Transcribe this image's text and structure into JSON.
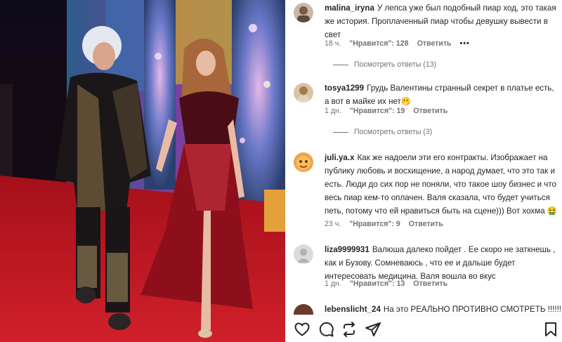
{
  "comments": [
    {
      "username": "malina_iryna",
      "text": "У лепса уже был подобный пиар ход, это такая же история. Проплаченный пиар чтобы девушку вывести в свет",
      "time": "18 ч.",
      "likes": "\"Нравится\": 128",
      "reply": "Ответить",
      "more": "•••",
      "view_replies": "Посмотреть ответы (13)"
    },
    {
      "username": "tosya1299",
      "text": "Грудь Валентины странный секрет в платье есть, а вот в майке их нет🫢",
      "time": "1 дн.",
      "likes": "\"Нравится\": 19",
      "reply": "Ответить",
      "view_replies": "Посмотреть ответы (3)"
    },
    {
      "username": "juli.ya.x",
      "text": "Как же надоели эти его контракты. Изображает на публику любовь и восхищение, а народ думает, что это так и есть. Люди до сих пор не поняли, что такое шоу бизнес и что весь пиар кем-то оплачен. Валя сказала, что будет учиться петь, потому что ей нравиться быть на сцене))) Вот хохма 🤮",
      "time": "23 ч.",
      "likes": "\"Нравится\": 9",
      "reply": "Ответить"
    },
    {
      "username": "liza9999931",
      "text": "Валюша далеко пойдет . Ее скоро не заткнешь , как и Бузову. Сомневаюсь , что ее и дальше будет интересовать медицина. Валя вошла во вкус",
      "time": "1 дн.",
      "likes": "\"Нравится\": 13",
      "reply": "Ответить"
    },
    {
      "username": "lebenslicht_24",
      "text": "На это РЕАЛЬНО ПРОТИВНО СМОТРЕТЬ !!!!!!!!!"
    }
  ],
  "actions": {
    "like_icon": "heart-icon",
    "comment_icon": "comment-icon",
    "repost_icon": "repost-icon",
    "share_icon": "send-icon",
    "save_icon": "bookmark-icon"
  },
  "colors": {
    "text": "#262626",
    "secondary": "#737373",
    "carpet": "#c0131b",
    "dress": "#8e0f1c"
  }
}
